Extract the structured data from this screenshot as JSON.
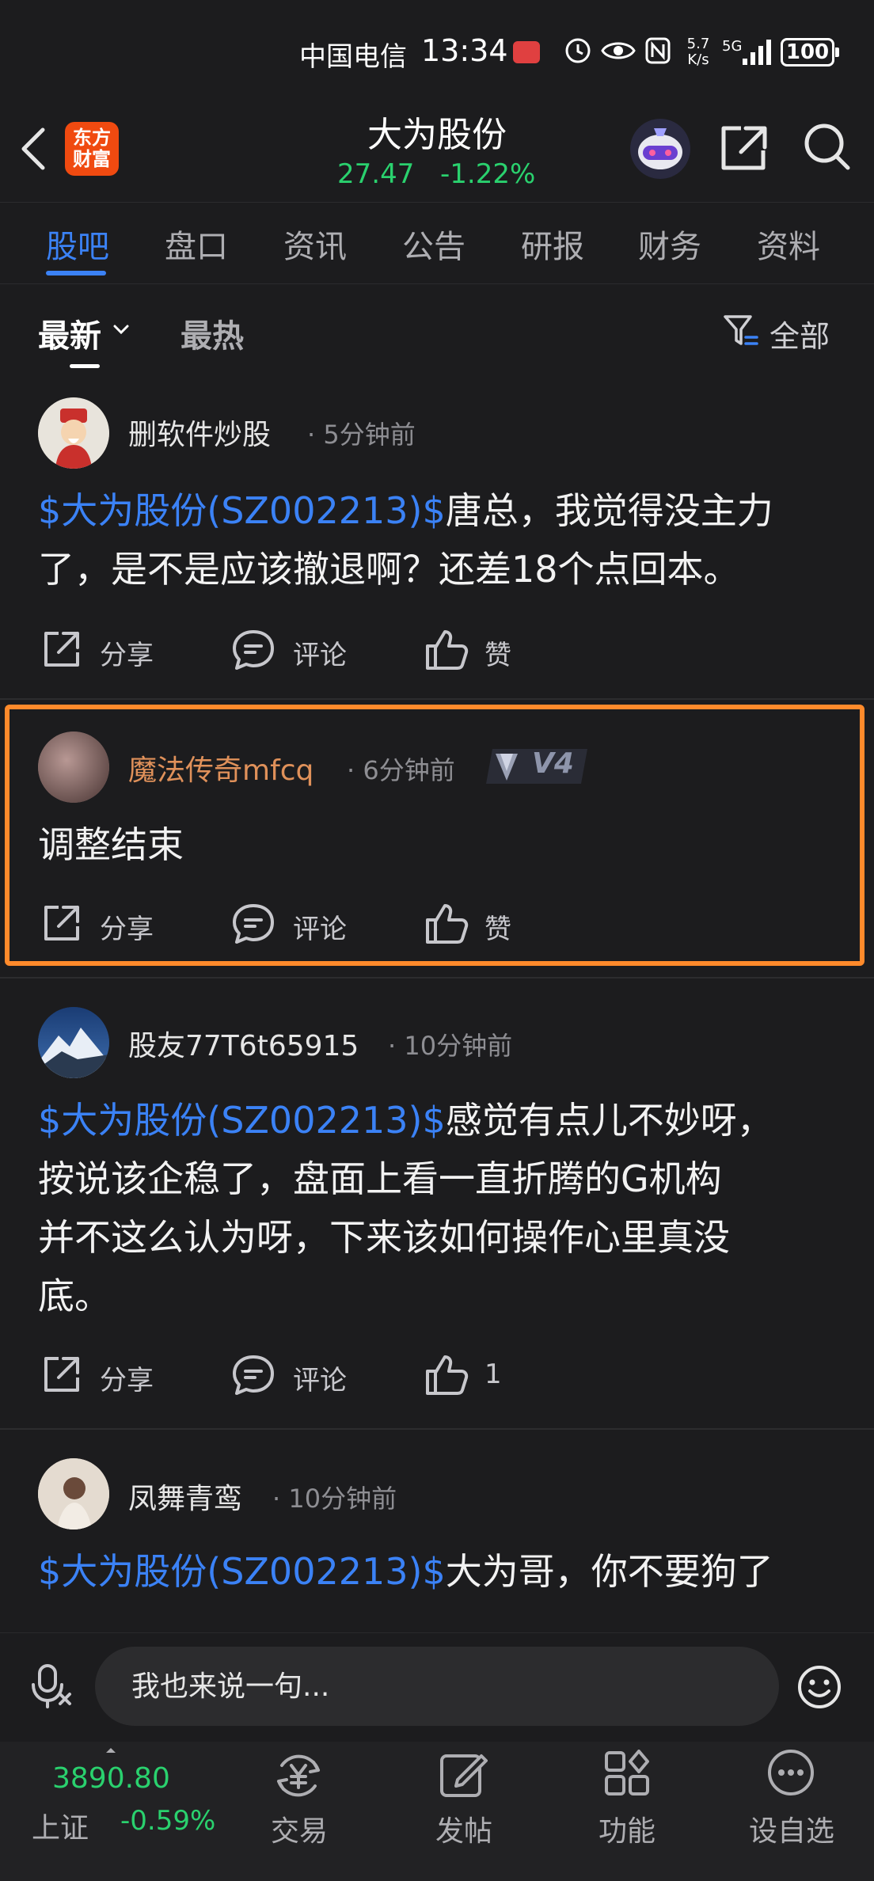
{
  "status_bar": {
    "carrier": "中国电信",
    "time": "13:34",
    "net_speed": "5.7\nK/s",
    "network": "5G",
    "battery": "100"
  },
  "header": {
    "logo_text": "东方\n财富",
    "stock_name": "大为股份",
    "price": "27.47",
    "change": "-1.22%"
  },
  "tabs": [
    {
      "label": "股吧",
      "active": true
    },
    {
      "label": "盘口"
    },
    {
      "label": "资讯"
    },
    {
      "label": "公告"
    },
    {
      "label": "研报"
    },
    {
      "label": "财务"
    },
    {
      "label": "资料"
    }
  ],
  "sort": {
    "latest": "最新",
    "hot": "最热",
    "filter": "全部"
  },
  "posts": [
    {
      "user": "删软件炒股",
      "time": "· 5分钟前",
      "tag": "$大为股份(SZ002213)$",
      "text_line1": "唐总，我觉得没主力",
      "text_line2": "了，是不是应该撤退啊？还差18个点回本。",
      "share": "分享",
      "comment": "评论",
      "like": "赞"
    },
    {
      "user": "魔法传奇mfcq",
      "time": "· 6分钟前",
      "level": "V4",
      "text": "调整结束",
      "share": "分享",
      "comment": "评论",
      "like": "赞"
    },
    {
      "user": "股友77T6t65915",
      "time": "· 10分钟前",
      "tag": "$大为股份(SZ002213)$",
      "text_line1": "感觉有点儿不妙呀，",
      "text_line2": "按说该企稳了，盘面上看一直折腾的G机构",
      "text_line3": "并不这么认为呀，下来该如何操作心里真没",
      "text_line4": "底。",
      "share": "分享",
      "comment": "评论",
      "like": "1"
    },
    {
      "user": "凤舞青鸾",
      "time": "· 10分钟前",
      "tag": "$大为股份(SZ002213)$",
      "text_line1": "大为哥，你不要狗了"
    }
  ],
  "input": {
    "placeholder": "我也来说一句..."
  },
  "bottom_nav": {
    "index_value": "3890.80",
    "index_name": "上证",
    "index_change": "-0.59%",
    "items": [
      {
        "label": "交易"
      },
      {
        "label": "发帖"
      },
      {
        "label": "功能"
      },
      {
        "label": "设自选"
      }
    ]
  },
  "colors": {
    "accent": "#3b82f6",
    "up_down_green": "#2ad16e",
    "highlight": "#ff8a2b",
    "logo": "#f04a10",
    "username_highlight": "#e0915a"
  }
}
